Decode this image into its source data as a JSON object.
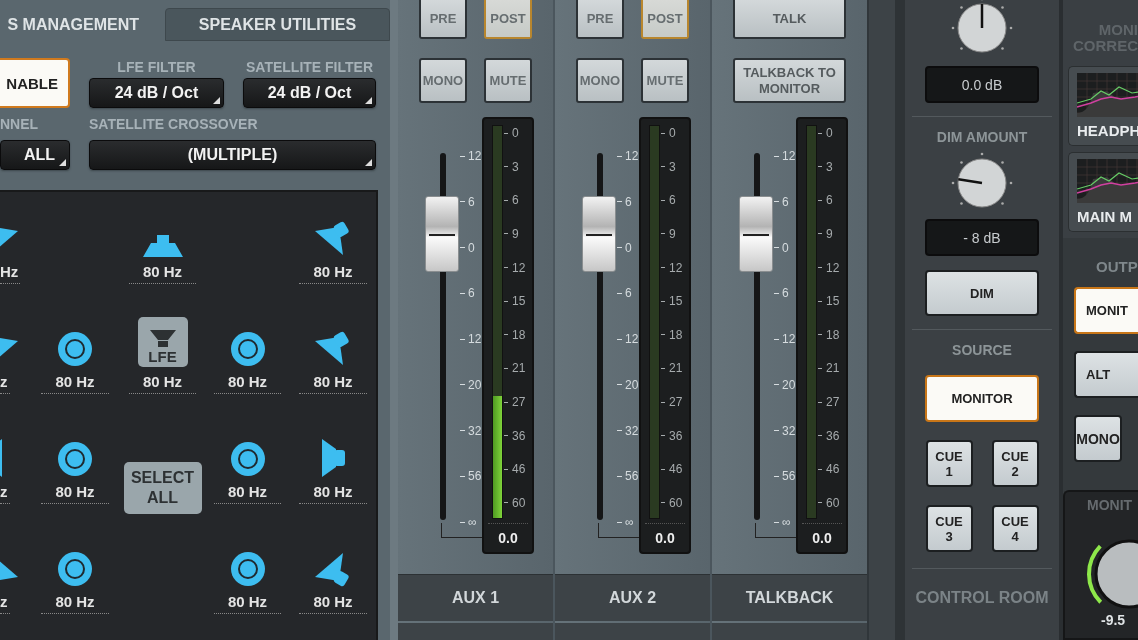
{
  "speaker_panel": {
    "tabs": [
      {
        "label": "S MANAGEMENT",
        "selected": true
      },
      {
        "label": "SPEAKER UTILITIES",
        "selected": false
      }
    ],
    "enable_button": {
      "label": "NABLE",
      "on": true
    },
    "lfe_filter": {
      "label": "LFE FILTER",
      "value": "24 dB / Oct"
    },
    "satellite_filter": {
      "label": "SATELLITE FILTER",
      "value": "24 dB / Oct"
    },
    "channel": {
      "label": "NNEL",
      "value": "ALL"
    },
    "satellite_crossover": {
      "label": "SATELLITE CROSSOVER",
      "value": "(MULTIPLE)"
    },
    "speakers": [
      [
        {
          "kind": "wedge",
          "label": "Hz"
        },
        {
          "kind": "empty"
        },
        {
          "kind": "top",
          "label": "80 Hz"
        },
        {
          "kind": "empty"
        },
        {
          "kind": "wedge",
          "label": "80 Hz"
        }
      ],
      [
        {
          "kind": "wedge",
          "label": "z"
        },
        {
          "kind": "ring",
          "label": "80 Hz"
        },
        {
          "kind": "lfe",
          "badge": "LFE",
          "label": "80 Hz"
        },
        {
          "kind": "ring",
          "label": "80 Hz"
        },
        {
          "kind": "wedge",
          "label": "80 Hz"
        }
      ],
      [
        {
          "kind": "side",
          "label": "z"
        },
        {
          "kind": "ring",
          "label": "80 Hz"
        },
        {
          "kind": "select",
          "label": "SELECT ALL"
        },
        {
          "kind": "ring",
          "label": "80 Hz"
        },
        {
          "kind": "side",
          "label": "80 Hz"
        }
      ],
      [
        {
          "kind": "rear",
          "label": "z"
        },
        {
          "kind": "ring",
          "label": "80 Hz"
        },
        {
          "kind": "empty"
        },
        {
          "kind": "ring",
          "label": "80 Hz"
        },
        {
          "kind": "rear",
          "label": "80 Hz"
        }
      ]
    ]
  },
  "mixer": {
    "channels": [
      {
        "name": "AUX 1",
        "top_buttons": [
          {
            "label": "PRE",
            "selected": false
          },
          {
            "label": "POST",
            "selected": true
          }
        ],
        "buttons": [
          {
            "label": "MONO",
            "on": false
          },
          {
            "label": "MUTE",
            "on": false
          }
        ],
        "fader": {
          "level": 0.78
        },
        "fader_scale": [
          "12",
          "6",
          "0",
          "6",
          "12",
          "20",
          "32",
          "56",
          "∞"
        ],
        "meter": {
          "level": 0.31
        },
        "meter_scale": [
          "0",
          "3",
          "6",
          "9",
          "12",
          "15",
          "18",
          "21",
          "27",
          "36",
          "46",
          "60"
        ],
        "readout": "0.0"
      },
      {
        "name": "AUX 2",
        "top_buttons": [
          {
            "label": "PRE",
            "selected": false
          },
          {
            "label": "POST",
            "selected": true
          }
        ],
        "buttons": [
          {
            "label": "MONO",
            "on": false
          },
          {
            "label": "MUTE",
            "on": false
          }
        ],
        "fader": {
          "level": 0.78
        },
        "fader_scale": [
          "12",
          "6",
          "0",
          "6",
          "12",
          "20",
          "32",
          "56",
          "∞"
        ],
        "meter_scale": [
          "0",
          "3",
          "6",
          "9",
          "12",
          "15",
          "18",
          "21",
          "27",
          "36",
          "46",
          "60"
        ],
        "readout": "0.0"
      },
      {
        "name": "TALKBACK",
        "top_buttons": [
          {
            "label": "TALK",
            "selected": false
          }
        ],
        "buttons": [
          {
            "label": "TALKBACK TO MONITOR",
            "on": false
          }
        ],
        "fader": {
          "level": 0.78
        },
        "fader_scale": [
          "12",
          "6",
          "0",
          "6",
          "12",
          "20",
          "32",
          "56",
          "∞"
        ],
        "meter_scale": [
          "0",
          "3",
          "6",
          "9",
          "12",
          "15",
          "18",
          "21",
          "27",
          "36",
          "46",
          "60"
        ],
        "readout": "0.0"
      }
    ]
  },
  "control_room": {
    "top_readout": "0.0 dB",
    "dim_label": "DIM AMOUNT",
    "dim_readout": "- 8 dB",
    "dim_button": {
      "label": "DIM",
      "on": false
    },
    "source_label": "SOURCE",
    "sources": [
      {
        "label": "MONITOR",
        "selected": true
      },
      {
        "label": "CUE 1",
        "selected": false
      },
      {
        "label": "CUE 2",
        "selected": false
      },
      {
        "label": "CUE 3",
        "selected": false
      },
      {
        "label": "CUE 4",
        "selected": false
      }
    ],
    "footer": "CONTROL ROOM"
  },
  "monitor_panel": {
    "correction_title": "MONI\nCORREC",
    "correction_cards": [
      {
        "label": "HEADPH"
      },
      {
        "label": "MAIN M"
      }
    ],
    "output_label": "OUTP",
    "outputs": [
      {
        "label": "MONIT",
        "selected": true
      },
      {
        "label": "ALT",
        "selected": false
      },
      {
        "label": "MONO",
        "selected": false
      }
    ],
    "monitor": {
      "label": "MONIT",
      "readout": "-9.5"
    }
  }
}
